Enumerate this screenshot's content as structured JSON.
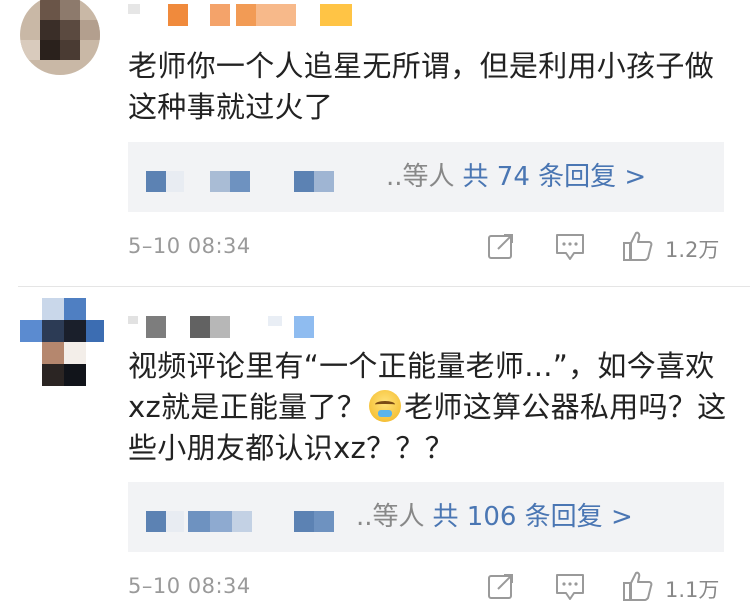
{
  "comments": [
    {
      "text": "老师你一个人追星无所谓，但是利用小孩子做这种事就过火了",
      "reply_suffix": "..等人",
      "reply_count": "共 74 条回复 >",
      "timestamp": "5–10 08:34",
      "likes": "1.2万",
      "icons": [
        "repost-icon",
        "comment-icon",
        "like-icon"
      ]
    },
    {
      "text_part1": "视频评论里有“一个正能量老师...”，如今喜欢xz就是正能量了？",
      "text_part2": "老师这算公器私用吗？这些小朋友都认识xz？？？",
      "emoji": "tired-face-emoji",
      "reply_suffix": "..等人",
      "reply_count": "共 106 条回复 >",
      "timestamp": "5–10 08:34",
      "likes": "1.1万",
      "icons": [
        "repost-icon",
        "comment-icon",
        "like-icon"
      ]
    }
  ],
  "colors": {
    "link_blue": "#4a76b3",
    "meta_gray": "#9a9a9a",
    "reply_bg": "#f2f3f5"
  }
}
